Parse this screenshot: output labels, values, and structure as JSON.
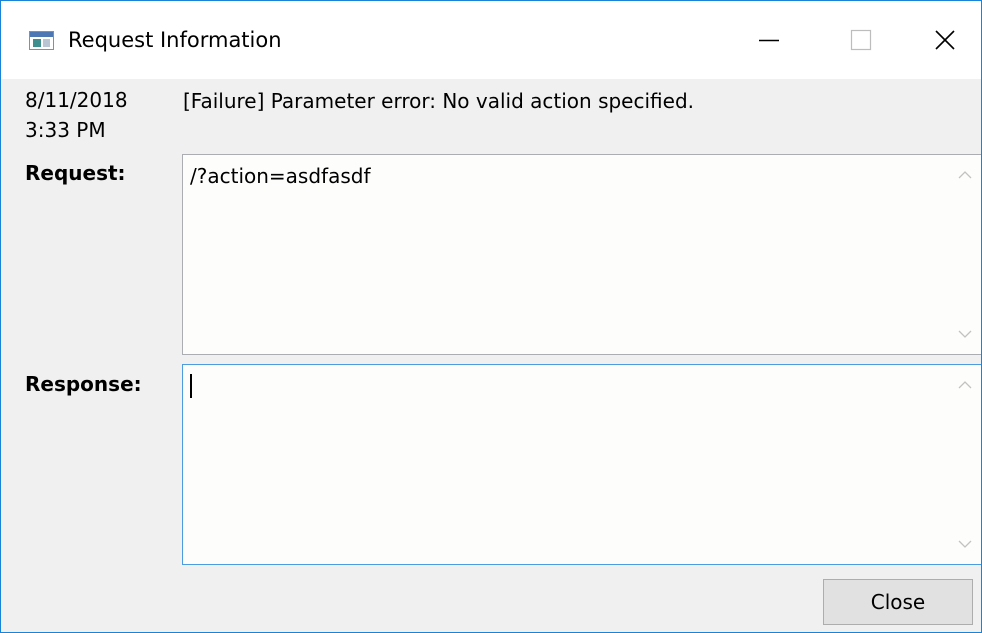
{
  "window": {
    "title": "Request Information",
    "accent_color": "#1883d7",
    "controls": {
      "minimize_icon": "minimize-icon",
      "maximize_icon": "maximize-icon",
      "close_icon": "close-icon"
    }
  },
  "entry": {
    "date": "8/11/2018",
    "time": "3:33 PM",
    "message": "[Failure] Parameter error: No valid action specified."
  },
  "request": {
    "label": "Request:",
    "value": "/?action=asdfasdf"
  },
  "response": {
    "label": "Response:",
    "value": ""
  },
  "footer": {
    "close_label": "Close"
  }
}
